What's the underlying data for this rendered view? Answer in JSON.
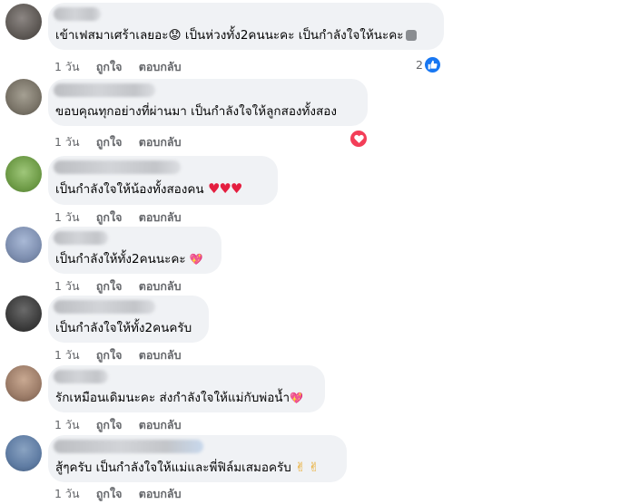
{
  "comments": [
    {
      "text": "เข้าเฟสมาเศร้าเลยอะ",
      "text_b": " เป็นห่วงทั้ง2คนนะคะ เป็นกำลังใจให้นะคะ",
      "time": "1 วัน",
      "like": "ถูกใจ",
      "reply": "ตอบกลับ",
      "reaction_count": "2"
    },
    {
      "text": "ขอบคุณทุกอย่างที่ผ่านมา เป็นกำลังใจให้ลูกสองทั้งสอง",
      "time": "1 วัน",
      "like": "ถูกใจ",
      "reply": "ตอบกลับ"
    },
    {
      "text": "เป็นกำลังใจให้น้องทั้งสองคน ",
      "time": "1 วัน",
      "like": "ถูกใจ",
      "reply": "ตอบกลับ"
    },
    {
      "text": "เป็นกำลังให้ทั้ง2คนนะคะ ",
      "time": "1 วัน",
      "like": "ถูกใจ",
      "reply": "ตอบกลับ"
    },
    {
      "text": "เป็นกำลังใจให้ทั้ง2คนครับ",
      "time": "1 วัน",
      "like": "ถูกใจ",
      "reply": "ตอบกลับ"
    },
    {
      "text": "รักเหมือนเดิมนะคะ ส่งกำลังใจให้แม่กับพ่อน้ำ",
      "time": "1 วัน",
      "like": "ถูกใจ",
      "reply": "ตอบกลับ"
    },
    {
      "text": "สู้ๆครับ เป็นกำลังใจให้แม่และพี่ฟิล์มเสมอครับ ",
      "time": "1 วัน",
      "like": "ถูกใจ",
      "reply": "ตอบกลับ"
    }
  ],
  "emoji": {
    "worried_face": "😟",
    "red_heart": "♥",
    "sparkling_heart": "💖",
    "victory_hand": "✌"
  },
  "colors": {
    "bubble_bg": "#f0f2f5",
    "meta_text": "#65676b",
    "like_blue": "#1877f2",
    "love_red": "#f33e58"
  }
}
